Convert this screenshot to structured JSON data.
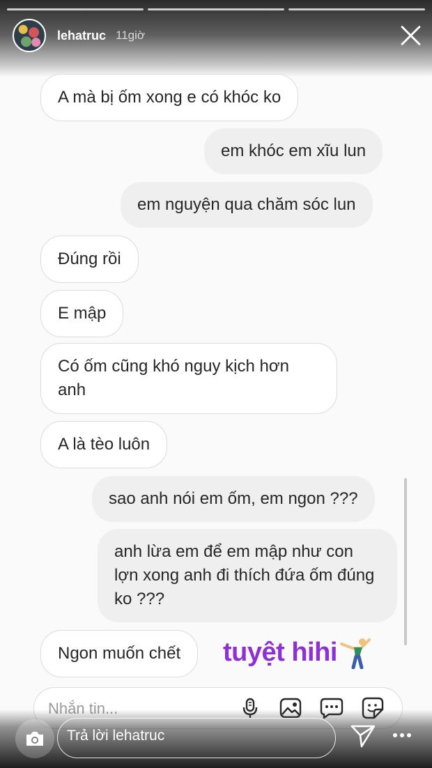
{
  "story": {
    "username": "lehatruc",
    "time": "11giờ",
    "segments": 3
  },
  "messages": [
    {
      "side": "in",
      "text": "A mà bị ốm xong e có khóc ko"
    },
    {
      "side": "out",
      "text": "em khóc em xĩu lun"
    },
    {
      "side": "out",
      "text": "em nguyện qua chăm sóc lun"
    },
    {
      "side": "in",
      "text": "Đúng rồi"
    },
    {
      "side": "in",
      "text": "E mập"
    },
    {
      "side": "in",
      "text": "Có ốm cũng khó nguy kịch hơn anh"
    },
    {
      "side": "in",
      "text": "A là tèo luôn"
    },
    {
      "side": "out",
      "text": "sao anh nói em ốm, em ngon ???"
    },
    {
      "side": "out",
      "text": "anh lừa em để em mập như con lợn xong anh đi thích đứa ốm đúng ko ???"
    },
    {
      "side": "in",
      "text": "Ngon muốn chết"
    }
  ],
  "sticker": {
    "text": "tuyệt hihi",
    "color": "#8e30d6"
  },
  "compose": {
    "placeholder": "Nhắn tin...",
    "icons": [
      "microphone-icon",
      "gallery-icon",
      "chat-bubble-icon",
      "sticker-icon"
    ]
  },
  "reply": {
    "placeholder": "Trả lời lehatruc"
  }
}
